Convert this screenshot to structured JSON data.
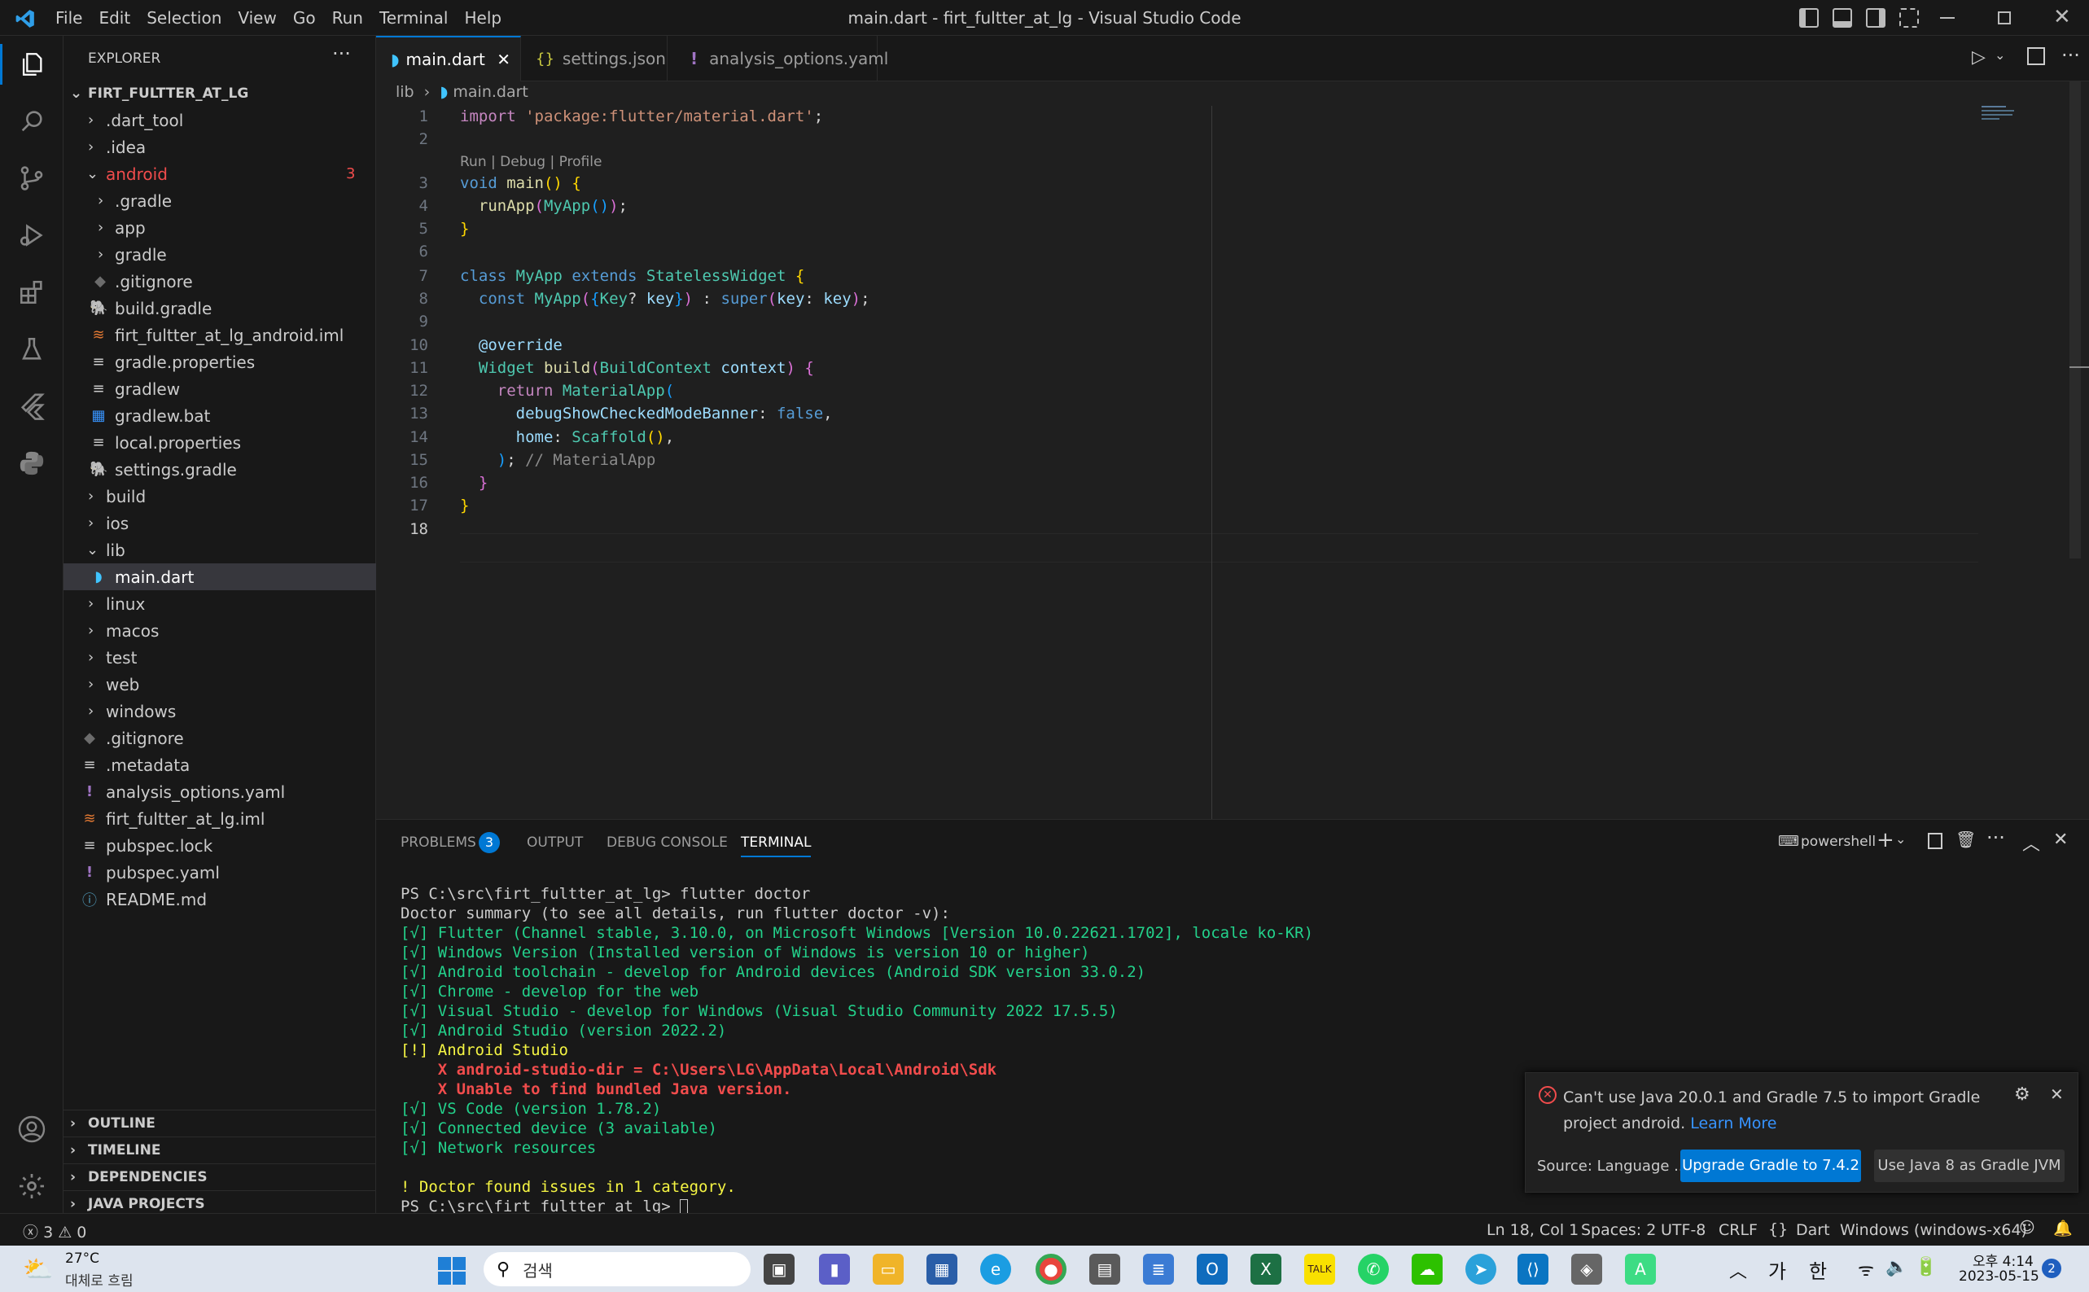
{
  "window": {
    "title": "main.dart - firt_fultter_at_lg - Visual Studio Code"
  },
  "menu": [
    "File",
    "Edit",
    "Selection",
    "View",
    "Go",
    "Run",
    "Terminal",
    "Help"
  ],
  "explorer": {
    "header": "EXPLORER",
    "root": "FIRT_FULTTER_AT_LG",
    "items": [
      {
        "label": ".dart_tool"
      },
      {
        "label": ".idea"
      },
      {
        "label": "android",
        "badge": "3"
      },
      {
        "label": ".gradle"
      },
      {
        "label": "app"
      },
      {
        "label": "gradle"
      },
      {
        "label": ".gitignore"
      },
      {
        "label": "build.gradle"
      },
      {
        "label": "firt_fultter_at_lg_android.iml"
      },
      {
        "label": "gradle.properties"
      },
      {
        "label": "gradlew"
      },
      {
        "label": "gradlew.bat"
      },
      {
        "label": "local.properties"
      },
      {
        "label": "settings.gradle"
      },
      {
        "label": "build"
      },
      {
        "label": "ios"
      },
      {
        "label": "lib"
      },
      {
        "label": "main.dart"
      },
      {
        "label": "linux"
      },
      {
        "label": "macos"
      },
      {
        "label": "test"
      },
      {
        "label": "web"
      },
      {
        "label": "windows"
      },
      {
        "label": ".gitignore"
      },
      {
        "label": ".metadata"
      },
      {
        "label": "analysis_options.yaml"
      },
      {
        "label": "firt_fultter_at_lg.iml"
      },
      {
        "label": "pubspec.lock"
      },
      {
        "label": "pubspec.yaml"
      },
      {
        "label": "README.md"
      }
    ],
    "sections": [
      "OUTLINE",
      "TIMELINE",
      "DEPENDENCIES",
      "JAVA PROJECTS"
    ]
  },
  "tabs": [
    "main.dart",
    "settings.json",
    "analysis_options.yaml"
  ],
  "breadcrumb": {
    "folder": "lib",
    "file": "main.dart"
  },
  "editor": {
    "codelens": "Run | Debug | Profile",
    "line_numbers": [
      "1",
      "2",
      "3",
      "4",
      "5",
      "6",
      "7",
      "8",
      "9",
      "10",
      "11",
      "12",
      "13",
      "14",
      "15",
      "16",
      "17",
      "18"
    ],
    "import_path": "'package:flutter/material.dart'",
    "comment": "// MaterialApp"
  },
  "panel": {
    "tabs": [
      "PROBLEMS",
      "OUTPUT",
      "DEBUG CONSOLE",
      "TERMINAL"
    ],
    "problems_count": "3",
    "shell": "powershell",
    "terminal": [
      "PS C:\\src\\firt_fultter_at_lg> flutter doctor",
      "Doctor summary (to see all details, run flutter doctor -v):",
      "[√] Flutter (Channel stable, 3.10.0, on Microsoft Windows [Version 10.0.22621.1702], locale ko-KR)",
      "[√] Windows Version (Installed version of Windows is version 10 or higher)",
      "[√] Android toolchain - develop for Android devices (Android SDK version 33.0.2)",
      "[√] Chrome - develop for the web",
      "[√] Visual Studio - develop for Windows (Visual Studio Community 2022 17.5.5)",
      "[√] Android Studio (version 2022.2)",
      "[!] Android Studio",
      "    X android-studio-dir = C:\\Users\\LG\\AppData\\Local\\Android\\Sdk",
      "    X Unable to find bundled Java version.",
      "[√] VS Code (version 1.78.2)",
      "[√] Connected device (3 available)",
      "[√] Network resources",
      "",
      "! Doctor found issues in 1 category.",
      "PS C:\\src\\firt_fultter_at_lg> "
    ]
  },
  "notification": {
    "message": "Can't use Java 20.0.1 and Gradle 7.5 to import Gradle project android.",
    "link": "Learn More",
    "source": "Source: Language ...",
    "primary_button": "Upgrade Gradle to 7.4.2",
    "secondary_button": "Use Java 8 as Gradle JVM"
  },
  "statusbar": {
    "errors": "3",
    "warnings": "0",
    "position": "Ln 18, Col 1",
    "spaces": "Spaces: 2",
    "encoding": "UTF-8",
    "eol": "CRLF",
    "language": "Dart",
    "device": "Windows (windows-x64)"
  },
  "taskbar": {
    "temperature": "27°C",
    "weather": "대체로 흐림",
    "search": "검색",
    "ime1": "가",
    "ime2": "한",
    "time": "오후 4:14",
    "date": "2023-05-15",
    "notif_count": "2"
  },
  "colors": {
    "accent": "#0078d4",
    "error": "#f14c4c",
    "background": "#1f1f1f"
  }
}
